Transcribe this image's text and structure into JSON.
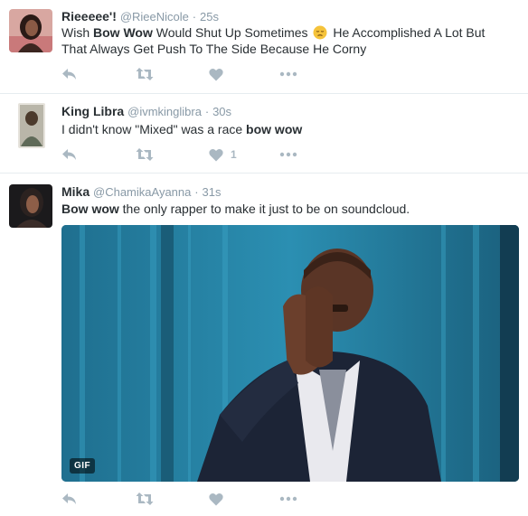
{
  "tweets": [
    {
      "name": "Rieeeee'!",
      "handle": "@RieeNicole",
      "dot": "·",
      "time": "25s",
      "text_parts": [
        "Wish ",
        "Bow Wow",
        " Would Shut Up Sometimes ",
        " He Accomplished A Lot But That Always Get Push To The Side Because He Corny"
      ],
      "emoji": "pensive-face-icon",
      "like_count": ""
    },
    {
      "name": "King Libra",
      "handle": "@ivmkinglibra",
      "dot": "·",
      "time": "30s",
      "text_parts": [
        "I didn't know \"Mixed\" was a race ",
        "bow wow"
      ],
      "like_count": "1"
    },
    {
      "name": "Mika",
      "handle": "@ChamikaAyanna",
      "dot": "·",
      "time": "31s",
      "text_parts": [
        "Bow wow",
        " the only rapper to make it just to be on soundcloud."
      ],
      "media_badge": "GIF",
      "like_count": ""
    }
  ],
  "icons": {
    "reply": "reply-icon",
    "retweet": "retweet-icon",
    "like": "heart-icon",
    "more": "more-dots-icon"
  },
  "colors": {
    "text": "#292f33",
    "muted": "#8899a6",
    "action": "#aab8c2",
    "divider": "#e6ecf0"
  }
}
